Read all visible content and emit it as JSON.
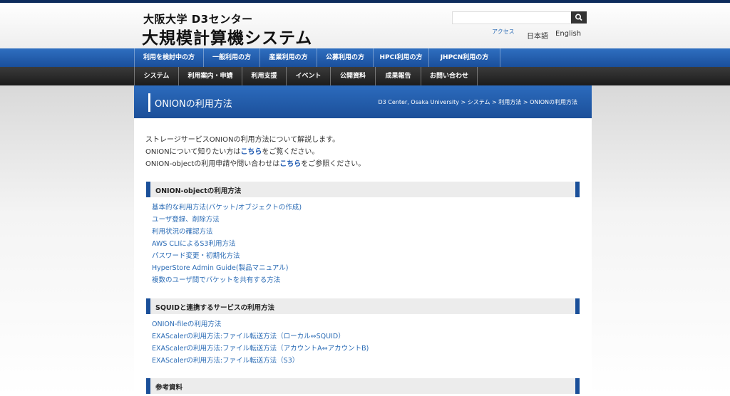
{
  "header": {
    "subtitle": "大阪大学 D3センター",
    "title": "大規模計算機システム",
    "search_placeholder": "",
    "access": "アクセス",
    "lang_ja": "日本語",
    "lang_en": "English"
  },
  "nav_primary": [
    {
      "label": "利用を検討中の方"
    },
    {
      "label": "一般利用の方"
    },
    {
      "label": "産業利用の方"
    },
    {
      "label": "公募利用の方"
    },
    {
      "label": "HPCI利用の方"
    },
    {
      "label": "JHPCN利用の方"
    }
  ],
  "nav_secondary": [
    {
      "label": "システム"
    },
    {
      "label": "利用案内・申請"
    },
    {
      "label": "利用支援"
    },
    {
      "label": "イベント"
    },
    {
      "label": "公開資料"
    },
    {
      "label": "成果報告"
    },
    {
      "label": "お問い合わせ"
    }
  ],
  "page": {
    "title": "ONIONの利用方法",
    "breadcrumb": "D3 Center, Osaka University > システム > 利用方法 > ONIONの利用方法"
  },
  "intro": {
    "line1": "ストレージサービスONIONの利用方法について解説します。",
    "line2_pre": "ONIONについて知りたい方は",
    "line2_link": "こちら",
    "line2_post": "をご覧ください。",
    "line3_pre": "ONION-objectの利用申請や問い合わせは",
    "line3_link": "こちら",
    "line3_post": "をご参照ください。"
  },
  "sections": [
    {
      "heading": "ONION-objectの利用方法",
      "links": [
        "基本的な利用方法(バケット/オブジェクトの作成)",
        "ユーザ登録、削除方法",
        "利用状況の確認方法",
        "AWS CLIによるS3利用方法",
        "パスワード変更・初期化方法",
        "HyperStore Admin Guide(製品マニュアル)",
        "複数のユーザ間でバケットを共有する方法"
      ]
    },
    {
      "heading": "SQUIDと連携するサービスの利用方法",
      "links": [
        "ONION-fileの利用方法",
        "EXAScalerの利用方法:ファイル転送方法（ローカル⇔SQUID）",
        "EXAScalerの利用方法:ファイル転送方法（アカウントA⇔アカウントB)",
        "EXAScalerの利用方法:ファイル転送方法（S3）"
      ]
    },
    {
      "heading": "参考資料",
      "links": []
    }
  ],
  "colors": {
    "nav_blue": "#1a4f9c",
    "nav_dark": "#2a2a2a",
    "link": "#2a6bb5"
  }
}
